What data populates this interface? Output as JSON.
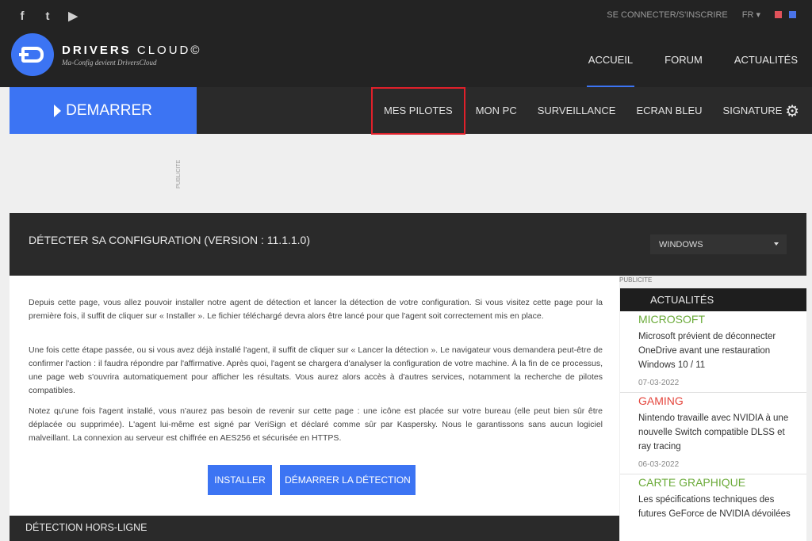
{
  "social": {
    "facebook": "f",
    "twitter": "t",
    "youtube": "▶"
  },
  "top": {
    "login": "SE CONNECTER/S'INSCRIRE",
    "lang": "FR ▾",
    "flag_colors": [
      "#e0525a",
      "#4a73e8"
    ]
  },
  "logo": {
    "title_bold": "DRIVERS",
    "title_light": "CLOUD",
    "reg": "©",
    "subtitle": "Ma-Config devient DriversCloud"
  },
  "mainnav": [
    "ACCUEIL",
    "FORUM",
    "ACTUALITÉS"
  ],
  "start_label": "DEMARRER",
  "subnav": [
    "MES PILOTES",
    "MON PC",
    "SURVEILLANCE",
    "ECRAN BLEU",
    "SIGNATURE"
  ],
  "ad_label": "PUBLICITE",
  "config": {
    "title": "DÉTECTER SA CONFIGURATION (VERSION : 11.1.1.0)",
    "os": "WINDOWS"
  },
  "paragraphs": [
    "Depuis cette page, vous allez pouvoir installer notre agent de détection et lancer la détection de votre configuration. Si vous visitez cette page pour la première fois, il suffit de cliquer sur « Installer ». Le fichier téléchargé devra alors être lancé pour que l'agent soit correctement mis en place.",
    "Une fois cette étape passée, ou si vous avez déjà installé l'agent, il suffit de cliquer sur « Lancer la détection ». Le navigateur vous demandera peut-être de confirmer l'action : il faudra répondre par l'affirmative. Après quoi, l'agent se chargera d'analyser la configuration de votre machine. À la fin de ce processus, une page web s'ouvrira automatiquement pour afficher les résultats. Vous aurez alors accès à d'autres services, notamment la recherche de pilotes compatibles.",
    "Notez qu'une fois l'agent installé, vous n'aurez pas besoin de revenir sur cette page : une icône est placée sur votre bureau (elle peut bien sûr être déplacée ou supprimée). L'agent lui-même est signé par VeriSign et déclaré comme sûr par Kaspersky. Nous le garantissons sans aucun logiciel malveillant. La connexion au serveur est chiffrée en AES256 et sécurisée en HTTPS."
  ],
  "buttons": {
    "install": "INSTALLER",
    "detect": "DÉMARRER LA DÉTECTION"
  },
  "offline_title": "DÉTECTION HORS-LIGNE",
  "sidebar": {
    "ad_label": "PUBLICITE",
    "news_title": "ACTUALITÉS",
    "news": [
      {
        "category": "MICROSOFT",
        "text": "Microsoft prévient de déconnecter OneDrive avant une restauration Windows 10 / 11",
        "date": "07-03-2022"
      },
      {
        "category": "GAMING",
        "text": "Nintendo travaille avec NVIDIA à une nouvelle Switch compatible DLSS et ray tracing",
        "date": "06-03-2022"
      },
      {
        "category": "CARTE GRAPHIQUE",
        "text": "Les spécifications techniques des futures GeForce de NVIDIA dévoilées",
        "date": ""
      }
    ]
  },
  "colors": {
    "accent": "#3c74f3",
    "highlight_border": "#e0202a",
    "cat_green": "#6aaa38",
    "cat_red": "#e4453c"
  }
}
